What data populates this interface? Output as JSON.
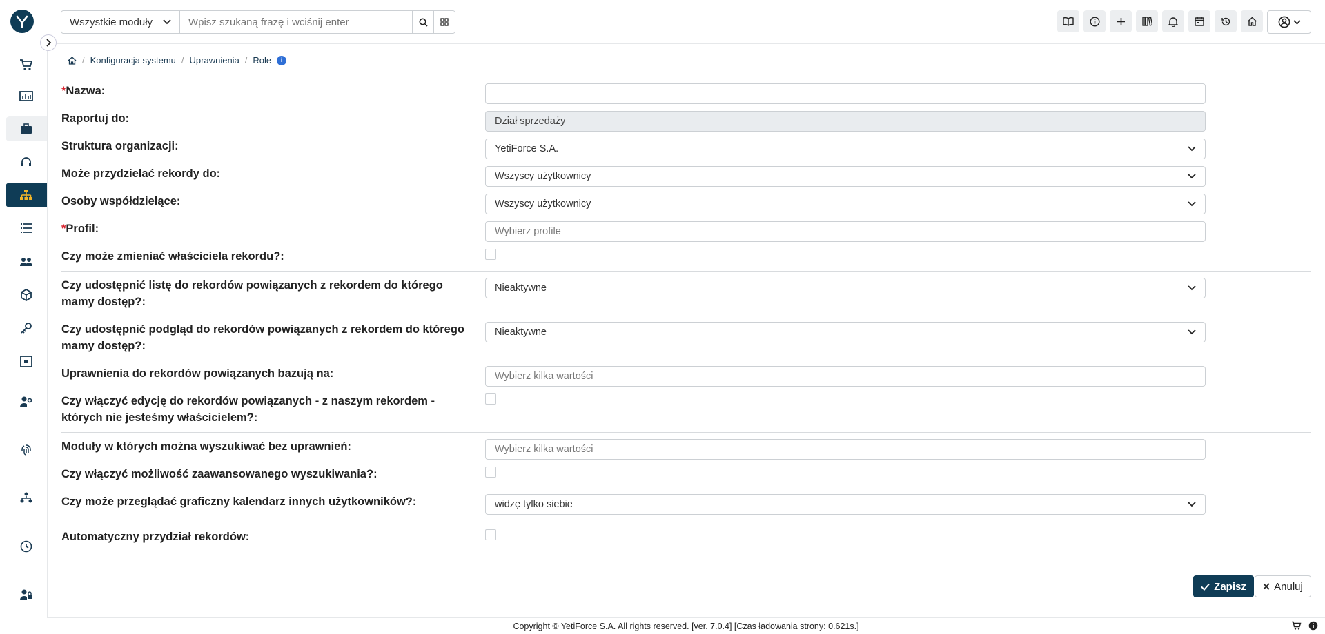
{
  "topbar": {
    "module_select": "Wszystkie moduły",
    "search_placeholder": "Wpisz szukaną frazę i wciśnij enter"
  },
  "breadcrumb": {
    "items": [
      "Konfiguracja systemu",
      "Uprawnienia",
      "Role"
    ]
  },
  "form": {
    "name_label": "Nazwa:",
    "name_value": "",
    "report_to_label": "Raportuj do:",
    "report_to_value": "Dział sprzedaży",
    "org_structure_label": "Struktura organizacji:",
    "org_structure_value": "YetiForce S.A.",
    "assign_records_label": "Może przydzielać rekordy do:",
    "assign_records_value": "Wszyscy użytkownicy",
    "co_sharing_label": "Osoby współdzielące:",
    "co_sharing_value": "Wszyscy użytkownicy",
    "profile_label": "Profil:",
    "profile_placeholder": "Wybierz profile",
    "change_owner_label": "Czy może zmieniać właściciela rekordu?:",
    "share_list_label_1": "Czy udostępnić listę do rekordów powiązanych z rekordem do którego",
    "share_list_label_2": "mamy dostęp?:",
    "share_list_value": "Nieaktywne",
    "share_preview_label_1": "Czy udostępnić podgląd do rekordów powiązanych z rekordem do którego",
    "share_preview_label_2": "mamy dostęp?:",
    "share_preview_value": "Nieaktywne",
    "related_perms_label": "Uprawnienia do rekordów powiązanych bazują na:",
    "related_perms_placeholder": "Wybierz kilka wartości",
    "edit_related_label_1": "Czy włączyć edycję do rekordów powiązanych - z naszym rekordem -",
    "edit_related_label_2": "których nie jesteśmy właścicielem?:",
    "search_modules_label": "Moduły w których można wyszukiwać bez uprawnień:",
    "search_modules_placeholder": "Wybierz kilka wartości",
    "advanced_search_label": "Czy włączyć możliwość zaawansowanego wyszukiwania?:",
    "calendar_label": "Czy może przeglądać graficzny kalendarz innych użytkowników?:",
    "calendar_value": "widzę tylko siebie",
    "auto_assign_label": "Automatyczny przydział rekordów:",
    "required_marker": "*"
  },
  "buttons": {
    "save": "Zapisz",
    "cancel": "Anuluj"
  },
  "footer": {
    "text": "Copyright © YetiForce S.A. All rights reserved. [ver. 7.0.4] [Czas ładowania strony: 0.621s.]"
  },
  "colors": {
    "primary": "#0f3c56",
    "required": "#d9232d",
    "info": "#2f6fd6"
  }
}
